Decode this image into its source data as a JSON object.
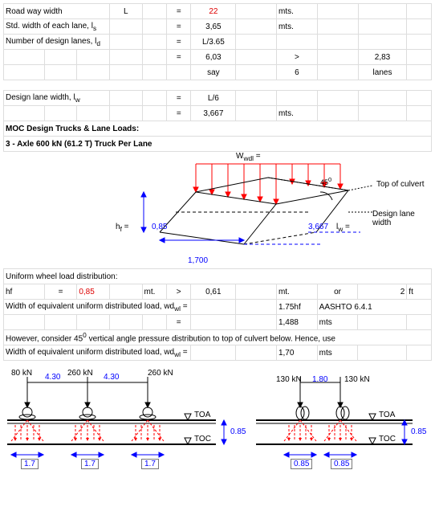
{
  "rows": {
    "roadway_label": "Road way width",
    "roadway_sym": "L",
    "roadway_val": "22",
    "roadway_unit": "mts.",
    "stdwidth_label": "Std. width of each lane, l",
    "stdwidth_sub": "s",
    "stdwidth_val": "3,65",
    "stdwidth_unit": "mts.",
    "numlanes_label": "Number of design lanes, l",
    "numlanes_sub": "d",
    "numlanes_expr": "L/3.65",
    "numlanes_val": "6,03",
    "numlanes_cmp": ">",
    "numlanes_cmpval": "2,83",
    "numlanes_say": "say",
    "numlanes_sayval": "6",
    "numlanes_sayunit": "lanes",
    "dlw_label": "Design lane width, l",
    "dlw_sub": "w",
    "dlw_expr": "L/6",
    "dlw_val": "3,667",
    "dlw_unit": "mts.",
    "eq": "="
  },
  "section1": "MOC Design Trucks & Lane Loads:",
  "section2": "3 - Axle 600 kN (61.2 T) Truck Per Lane",
  "diag1": {
    "Wwdl": "W",
    "Wwdl_sub": "wdl",
    "Wwdl_eq": " =",
    "topculvert": "Top of culvert",
    "dlw": "Design lane width",
    "ang": "45",
    "ang_sup": "0",
    "hf_lbl": "h",
    "hf_sub": "f",
    "hf_eq": " =",
    "hf_val": "0,85",
    "lw_val": "3,667",
    "lw_lbl": "l",
    "lw_sub": "w",
    "lw_eq": " =",
    "bottom": "1,700"
  },
  "uwl": {
    "title": "Uniform wheel load distribution:",
    "hf_lbl": "hf",
    "hf_eq": "=",
    "hf_val": "0,85",
    "hf_unit": "mt.",
    "hf_cmp": ">",
    "hf_cmpval": "0,61",
    "hf_cmpunit": "mt.",
    "hf_or": "or",
    "hf_ft": "2",
    "hf_ftunit": "ft",
    "wdwl_label": "Width of equivalent uniform distributed load, wd",
    "wdwl_sub": "wl",
    "wdwl_eq": "  =",
    "wdwl_expr": "1.75hf",
    "wdwl_ref": "AASHTO 6.4.1",
    "wdwl_val": "1,488",
    "wdwl_unit": "mts",
    "however": "However, consider 45",
    "however_sup": "0",
    "however_rest": " vertical angle pressure distribution to top of culvert below. Hence, use",
    "wdwl2_val": "1,70",
    "wdwl2_unit": "mts",
    "eq": "="
  },
  "diag2": {
    "left": {
      "p1": "80 kN",
      "d1": "4.30",
      "p2": "260 kN",
      "d2": "4.30",
      "p3": "260 kN",
      "s1": "1.7",
      "s2": "1.7",
      "s3": "1.7"
    },
    "right": {
      "p1": "130 kN",
      "d1": "1.80",
      "p2": "130 kN",
      "s1": "0.85",
      "s2": "0.85"
    },
    "TOA": "TOA",
    "TOC": "TOC",
    "h1": "0.85",
    "h2": "0.85"
  }
}
